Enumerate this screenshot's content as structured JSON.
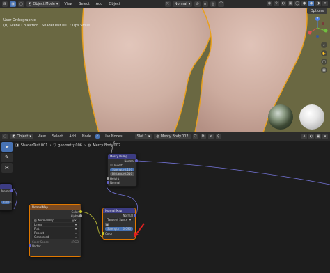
{
  "viewport": {
    "mode": "Object Mode",
    "menu": [
      "View",
      "Select",
      "Add",
      "Object"
    ],
    "shading": "Normal",
    "options_label": "Options",
    "info_line1": "User Orthographic",
    "info_line2": "(0) Scene Collection | ShaderTest.001 : Lips Smile",
    "gizmo_axes": {
      "z": "Z",
      "x": "X",
      "y": "Y"
    },
    "colors": {
      "background": "#6a6842",
      "outline": "#e8a020",
      "skin": "#d2b4a8"
    }
  },
  "node_editor": {
    "editor_type": "Object",
    "menu": [
      "View",
      "Select",
      "Add",
      "Node"
    ],
    "use_nodes_label": "Use Nodes",
    "slot": "Slot 1",
    "material": "Mercy Body.002",
    "breadcrumbs": [
      "ShaderTest.001",
      "geometry.006",
      "Mercy Body.002"
    ],
    "nodes": {
      "bump": {
        "title": "Mercy Bump",
        "out_normal": "Normal",
        "invert": "Invert",
        "strength_label": "Strength",
        "strength_value": "0.150",
        "distance_label": "Distance",
        "distance_value": "0.010",
        "in_height": "Height",
        "in_normal": "Normal"
      },
      "left": {
        "title": "",
        "in_normal": "Normal",
        "value": "0.010"
      },
      "normalmap_image": {
        "title": "NormalMap",
        "out_color": "Color",
        "out_alpha": "Alpha",
        "image_name": "NormalMap",
        "interpolation": "Linear",
        "projection": "Flat",
        "extension": "Repeat",
        "source": "Generated",
        "color_space_label": "Color Space",
        "color_space_value": "sRGB",
        "in_vector": "Vector"
      },
      "normal_map": {
        "title": "Normal Map",
        "out_normal": "Normal",
        "space": "Tangent Space",
        "strength_label": "Strength",
        "strength_value": "0.090",
        "in_color": "Color"
      }
    }
  }
}
